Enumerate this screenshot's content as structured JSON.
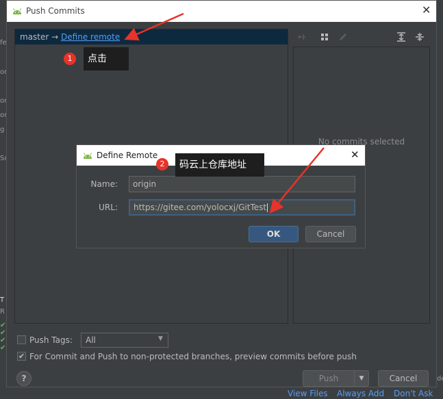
{
  "window": {
    "title": "Push Commits"
  },
  "branch": {
    "name": "master",
    "arrow": "→",
    "define_remote_link": "Define remote"
  },
  "commits_panel": {
    "empty_text": "No commits selected"
  },
  "options": {
    "push_tags_label": "Push Tags:",
    "push_tags_value": "All",
    "preview_label": "For Commit and Push to non-protected branches, preview commits before push"
  },
  "buttons": {
    "help": "?",
    "push": "Push",
    "cancel": "Cancel"
  },
  "define_remote": {
    "title": "Define Remote",
    "name_label": "Name:",
    "name_value": "origin",
    "url_label": "URL:",
    "url_value": "https://gitee.com/yolocxj/GitTest",
    "ok": "OK",
    "cancel": "Cancel"
  },
  "annotations": [
    {
      "number": "1",
      "text": "点击"
    },
    {
      "number": "2",
      "text": "码云上仓库地址"
    }
  ],
  "background": {
    "left_fragments": [
      "fe",
      "on",
      "on",
      "on",
      "g",
      "Sc",
      "T",
      "R"
    ],
    "bottom_links": [
      "View Files",
      "Always Add",
      "Don't Ask Ag"
    ],
    "right_fragment": "de"
  },
  "colors": {
    "accent": "#589df6",
    "selection": "#0d293e",
    "annotation_red": "#e8332a",
    "ok_blue": "#365880"
  }
}
